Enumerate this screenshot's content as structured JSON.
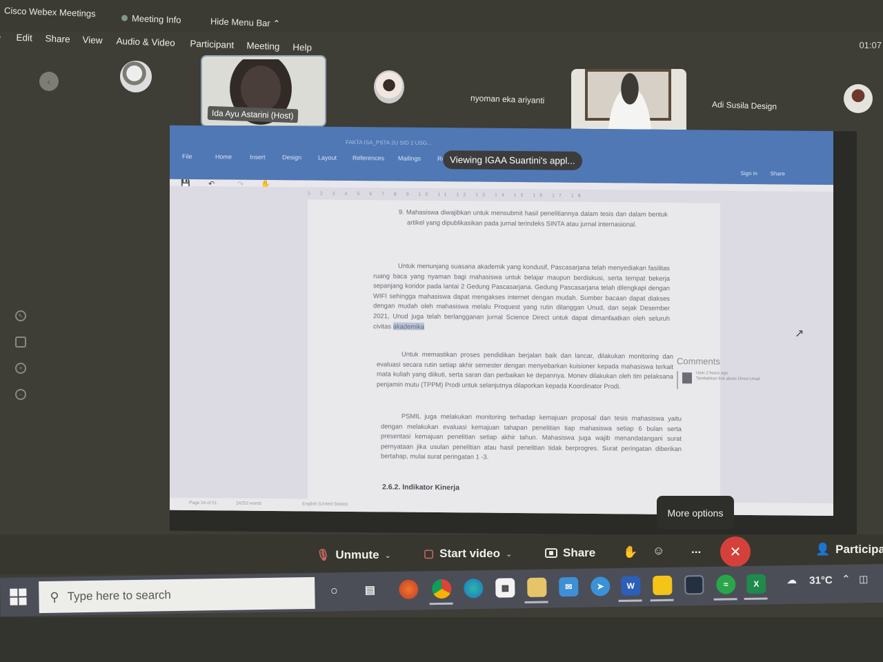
{
  "window": {
    "app_title": "Cisco Webex Meetings",
    "meeting_info": "Meeting Info",
    "hide_menu_bar": "Hide Menu Bar",
    "clock": "01:07"
  },
  "menu": [
    "File",
    "Edit",
    "Share",
    "View",
    "Audio & Video",
    "Participant",
    "Meeting",
    "Help"
  ],
  "participants": {
    "host_label": "Ida Ayu Astarini (Host)",
    "names": [
      "nyoman eka ariyanti",
      "Adi Susila Design"
    ]
  },
  "shared_content": {
    "viewing_badge": "Viewing IGAA Suartini's appl...",
    "word_title": "FAKTA ISA_PSTA 2U SID 2 USG...",
    "word_tabs": [
      "File",
      "Home",
      "Insert",
      "Design",
      "Layout",
      "References",
      "Mailings",
      "Review"
    ],
    "sign_in": "Sign in",
    "share": "Share",
    "ruler": "1 2 3 4 5 6 7 8 9 10 11 12 13 14 15 16 17 18",
    "item9": "9. Mahasiswa diwajibkan untuk mensubmit hasil penelitiannya dalam tesis dan dalam bentuk artikel yang dipublikasikan pada jurnal terindeks SINTA atau jurnal internasional.",
    "paragraph1_main": "Untuk menunjang suasana akademik yang kondusif, Pascasarjana telah menyediakan fasilitas ruang baca yang nyaman bagi mahasiswa untuk belajar maupun berdiskusi, serta tempat bekerja sepanjang koridor pada lantai 2 Gedung Pascasarjana. Gedung Pascasarjana telah dilengkapi dengan WIFI sehingga mahasiswa dapat mengakses internet dengan mudah. Sumber bacaan dapat diakses dengan mudah oleh mahasiswa melalu Proquest yang rutin dilanggan Unud, dan sejak Desember 2021, Unud juga telah berlangganan jurnal Science Direct untuk dapat dimanfaatkan oleh seluruh civitas",
    "paragraph1_highlight": "akademika",
    "paragraph2": "Untuk memastikan proses pendidikan berjalan baik dan lancar, dilakukan monitoring dan evaluasi secara rutin setiap akhir semester dengan menyebarkan kuisioner kepada mahasiswa terkait mata kuliah yang diikuti, serta saran dan perbaikan ke depannya. Monev dilakukan oleh tim pelaksana penjamin mutu (TPPM) Prodi untuk selanjutnya dilaporkan kepada Koordinator Prodi.",
    "paragraph3": "PSMIL juga melakukan monitoring terhadap kemajuan proposal dan tesis mahasiswa yaitu dengan melakukan evaluasi kemajuan tahapan penelitian tiap mahasiswa setiap 6 bulan serta presentasi kemajuan penelitian setiap akhir tahun. Mahasiswa juga wajib menandatangani surat pernyataan jika usulan penelitian atau hasil penelitian tidak berprogres. Surat peringatan diberikan bertahap, mulai surat peringatan 1 -3.",
    "heading": "2.6.2. Indikator Kinerja",
    "comments_title": "Comments",
    "comment_meta": "User 2 hours ago",
    "comment_text": "Tambahkan link akses Direct Unud",
    "status_page": "Page 24 of 51",
    "status_words": "24253 words",
    "status_lang": "English (United States)"
  },
  "controls": {
    "more_options_tooltip": "More options",
    "unmute": "Unmute",
    "start_video": "Start video",
    "share": "Share",
    "more": "...",
    "participants": "Participants"
  },
  "taskbar": {
    "search_placeholder": "Type here to search",
    "temperature": "31°C",
    "apps": [
      "Firefox",
      "Chrome",
      "Edge",
      "Store",
      "File Explorer",
      "Mail",
      "Telegram",
      "Word",
      "Sticky Notes",
      "Webex",
      "Spotify",
      "Excel"
    ]
  }
}
